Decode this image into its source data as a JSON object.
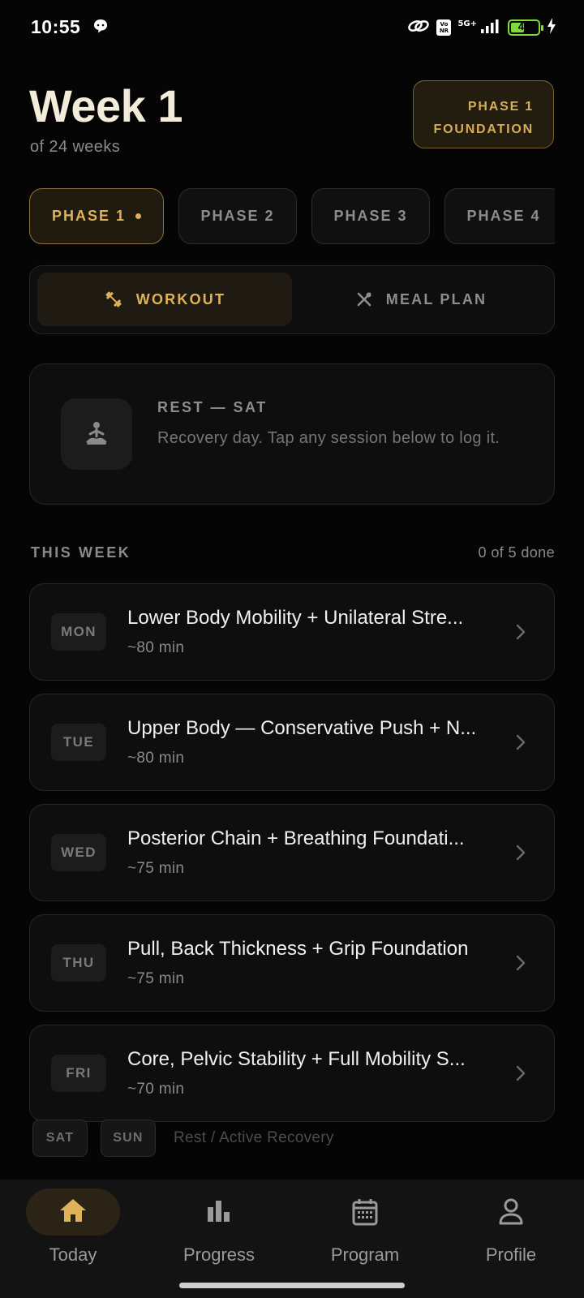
{
  "status_bar": {
    "time": "10:55",
    "network": "5G+",
    "volte_badge": "Vo NR",
    "battery": "49",
    "battery_level": 0.49,
    "icons": [
      "chat-bubble-icon",
      "link-icon",
      "signal-icon",
      "battery-icon",
      "charging-bolt-icon"
    ]
  },
  "header": {
    "title": "Week 1",
    "subtitle": "of 24 weeks",
    "phase_badge_line1": "PHASE 1",
    "phase_badge_line2": "FOUNDATION"
  },
  "phase_tabs": [
    {
      "label": "PHASE 1",
      "active": true
    },
    {
      "label": "PHASE 2",
      "active": false
    },
    {
      "label": "PHASE 3",
      "active": false
    },
    {
      "label": "PHASE 4",
      "active": false
    }
  ],
  "segmented": {
    "workout_label": "WORKOUT",
    "workout_icon": "dumbbell-icon",
    "meal_label": "MEAL PLAN",
    "meal_icon": "utensils-icon",
    "selected": "workout"
  },
  "rest_card": {
    "icon": "meditation-icon",
    "title": "REST — SAT",
    "text": "Recovery day. Tap any session below to log it."
  },
  "this_week": {
    "label": "THIS WEEK",
    "count": "0 of 5 done",
    "days": [
      {
        "day": "MON",
        "title": "Lower Body Mobility + Unilateral Stre...",
        "duration": "~80 min"
      },
      {
        "day": "TUE",
        "title": "Upper Body — Conservative Push + N...",
        "duration": "~80 min"
      },
      {
        "day": "WED",
        "title": "Posterior Chain + Breathing Foundati...",
        "duration": "~75 min"
      },
      {
        "day": "THU",
        "title": "Pull, Back Thickness + Grip Foundation",
        "duration": "~75 min"
      },
      {
        "day": "FRI",
        "title": "Core, Pelvic Stability + Full Mobility S...",
        "duration": "~70 min"
      }
    ],
    "weekend": {
      "sat": "SAT",
      "sun": "SUN",
      "text": "Rest / Active Recovery"
    }
  },
  "bottom_nav": [
    {
      "label": "Today",
      "icon": "home-icon",
      "active": true
    },
    {
      "label": "Progress",
      "icon": "bar-chart-icon",
      "active": false
    },
    {
      "label": "Program",
      "icon": "calendar-icon",
      "active": false
    },
    {
      "label": "Profile",
      "icon": "person-icon",
      "active": false
    }
  ],
  "colors": {
    "background": "#050505",
    "accent_gold": "#dfb25a",
    "card": "#0e0e0e",
    "border": "#262626"
  }
}
